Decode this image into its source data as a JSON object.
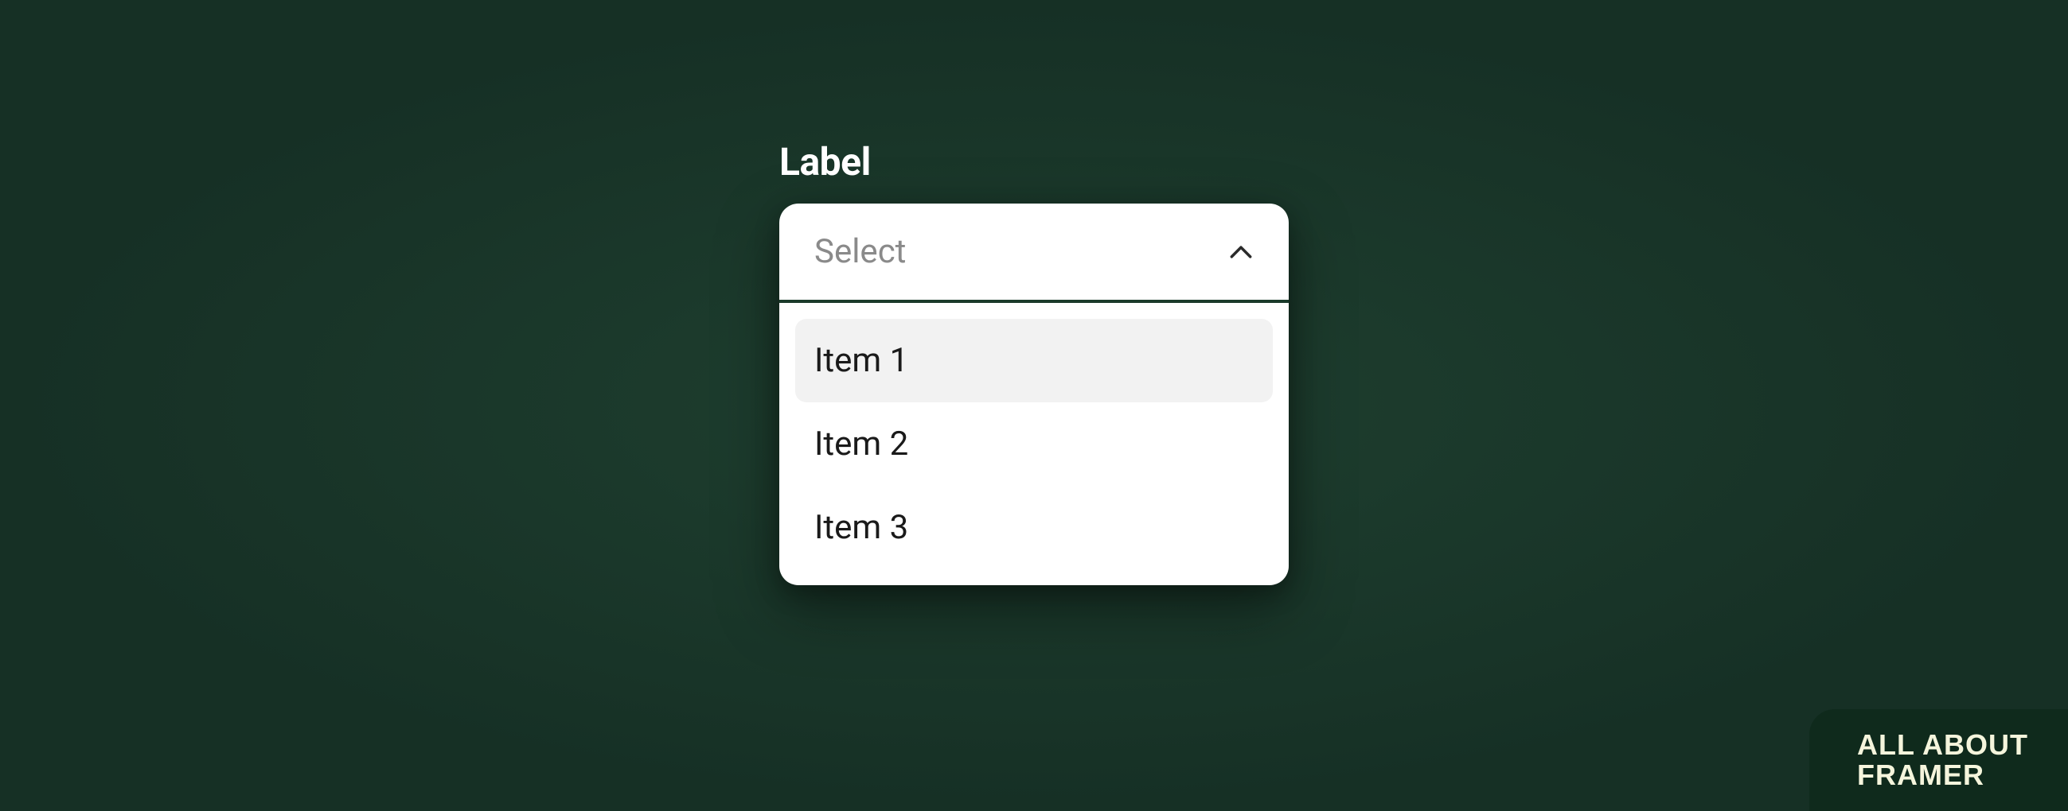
{
  "dropdown": {
    "label": "Label",
    "placeholder": "Select",
    "options": [
      {
        "label": "Item 1",
        "highlighted": true
      },
      {
        "label": "Item 2",
        "highlighted": false
      },
      {
        "label": "Item 3",
        "highlighted": false
      }
    ]
  },
  "watermark": {
    "line1": "ALL ABOUT",
    "line2": "FRAMER"
  }
}
